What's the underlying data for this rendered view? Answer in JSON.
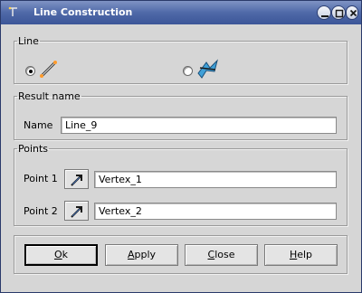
{
  "window": {
    "title": "Line Construction",
    "title_icon": "line-construction-icon"
  },
  "titlebar_buttons": [
    "minimize",
    "maximize",
    "close"
  ],
  "line_group": {
    "legend": "Line",
    "options": [
      {
        "icon": "line-two-points-icon",
        "checked": true
      },
      {
        "icon": "line-intersection-icon",
        "checked": false
      }
    ]
  },
  "result_group": {
    "legend": "Result name",
    "name_label": "Name",
    "name_value": "Line_9"
  },
  "points_group": {
    "legend": "Points",
    "point1_label": "Point 1",
    "point1_value": "Vertex_1",
    "point2_label": "Point 2",
    "point2_value": "Vertex_2",
    "select_icon": "select-arrow-icon"
  },
  "buttons": {
    "ok": {
      "u": "O",
      "rest": "k"
    },
    "apply": {
      "u": "A",
      "rest": "pply"
    },
    "close": {
      "u": "C",
      "rest": "lose"
    },
    "help": {
      "u": "H",
      "rest": "elp"
    }
  }
}
